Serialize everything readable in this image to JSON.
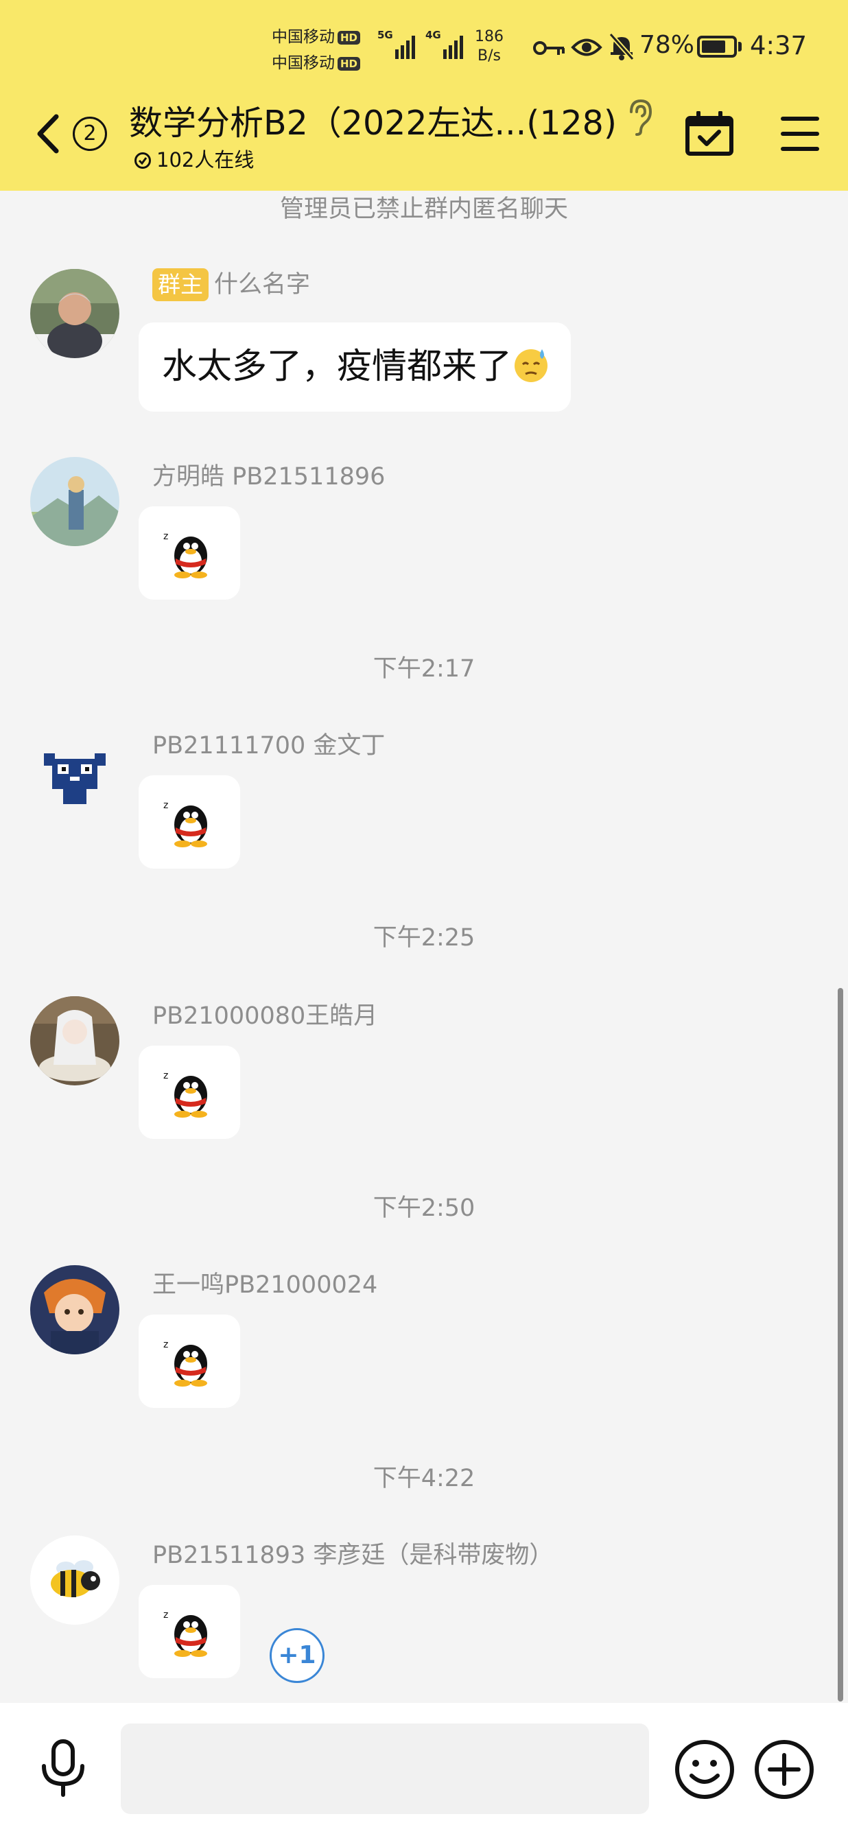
{
  "status_bar": {
    "carrier1": "中国移动",
    "carrier2": "中国移动",
    "hd": "HD",
    "sig1_tag": "5G",
    "sig2_tag": "4G",
    "speed_value": "186",
    "speed_unit": "B/s",
    "battery_text": "78%",
    "battery_level": 0.78,
    "time": "4:37"
  },
  "header": {
    "unread_count": "2",
    "title": "数学分析B2（2022左达...(128)",
    "online_text": "102人在线"
  },
  "chat": {
    "system_notice": "管理员已禁止群内匿名聊天",
    "timestamps": [
      "下午2:17",
      "下午2:25",
      "下午2:50",
      "下午4:22"
    ],
    "messages": [
      {
        "owner_tag": "群主",
        "sender": "什么名字",
        "text": "水太多了，疫情都来了"
      },
      {
        "sender": "方明皓 PB21511896"
      },
      {
        "sender": "PB21111700 金文丁"
      },
      {
        "sender": "PB21000080王皓月"
      },
      {
        "sender": "王一鸣PB21000024"
      },
      {
        "sender": "PB21511893 李彦廷（是科带废物）"
      }
    ],
    "reaction": "+1"
  },
  "colors": {
    "header_bg": "#f9e869",
    "owner_tag": "#f4c543",
    "accent_blue": "#3a86d6"
  },
  "icons": [
    "back-icon",
    "ear-icon",
    "calendar-check-icon",
    "menu-icon",
    "qq-penguin-sticker",
    "mic-icon",
    "emoji-icon",
    "plus-icon"
  ]
}
